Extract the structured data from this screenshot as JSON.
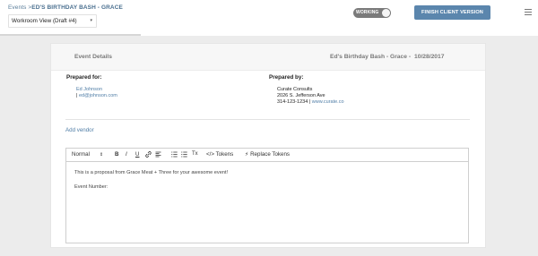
{
  "breadcrumb": {
    "root": "Events",
    "separator": " >",
    "current": "ED'S BIRTHDAY BASH - GRACE"
  },
  "view_select": {
    "value": "Workroom View (Draft #4)",
    "caret": "▾"
  },
  "status_toggle": {
    "label": "WORKING"
  },
  "finish_button": {
    "label": "FINISH CLIENT VERSION"
  },
  "card": {
    "title": "Event Details",
    "event_name": "Ed's Birthday Bash - Grace -",
    "event_date": "10/28/2017"
  },
  "prepared_for": {
    "label": "Prepared for:",
    "name": "Ed Johnson",
    "pipe": "| ",
    "email": "ed@johnson.com"
  },
  "prepared_by": {
    "label": "Prepared by:",
    "company": "Curate Consults",
    "address": "2026 S. Jefferson Ave",
    "phone": "314-123-1234 | ",
    "website": "www.curate.co"
  },
  "add_vendor": "Add vendor",
  "toolbar": {
    "format": "Normal",
    "format_caret": "⇕",
    "bold": "B",
    "italic": "I",
    "underline": "U",
    "link_icon": "link-icon",
    "align_icon": "align-icon",
    "ordered_list_icon": "ordered-list-icon",
    "bullet_list_icon": "bullet-list-icon",
    "clear_format": "Tx",
    "tokens": "Tokens",
    "tokens_icon_text": "</>",
    "replace_tokens": "Replace Tokens",
    "replace_icon_text": "⚡"
  },
  "editor": {
    "line1": "This is a proposal from Grace Meat + Three for your awesome event!",
    "line2": "Event Number:"
  },
  "colors": {
    "accent": "#5b86ad",
    "link": "#4f7da6",
    "status_pill": "#7a7a7a"
  }
}
